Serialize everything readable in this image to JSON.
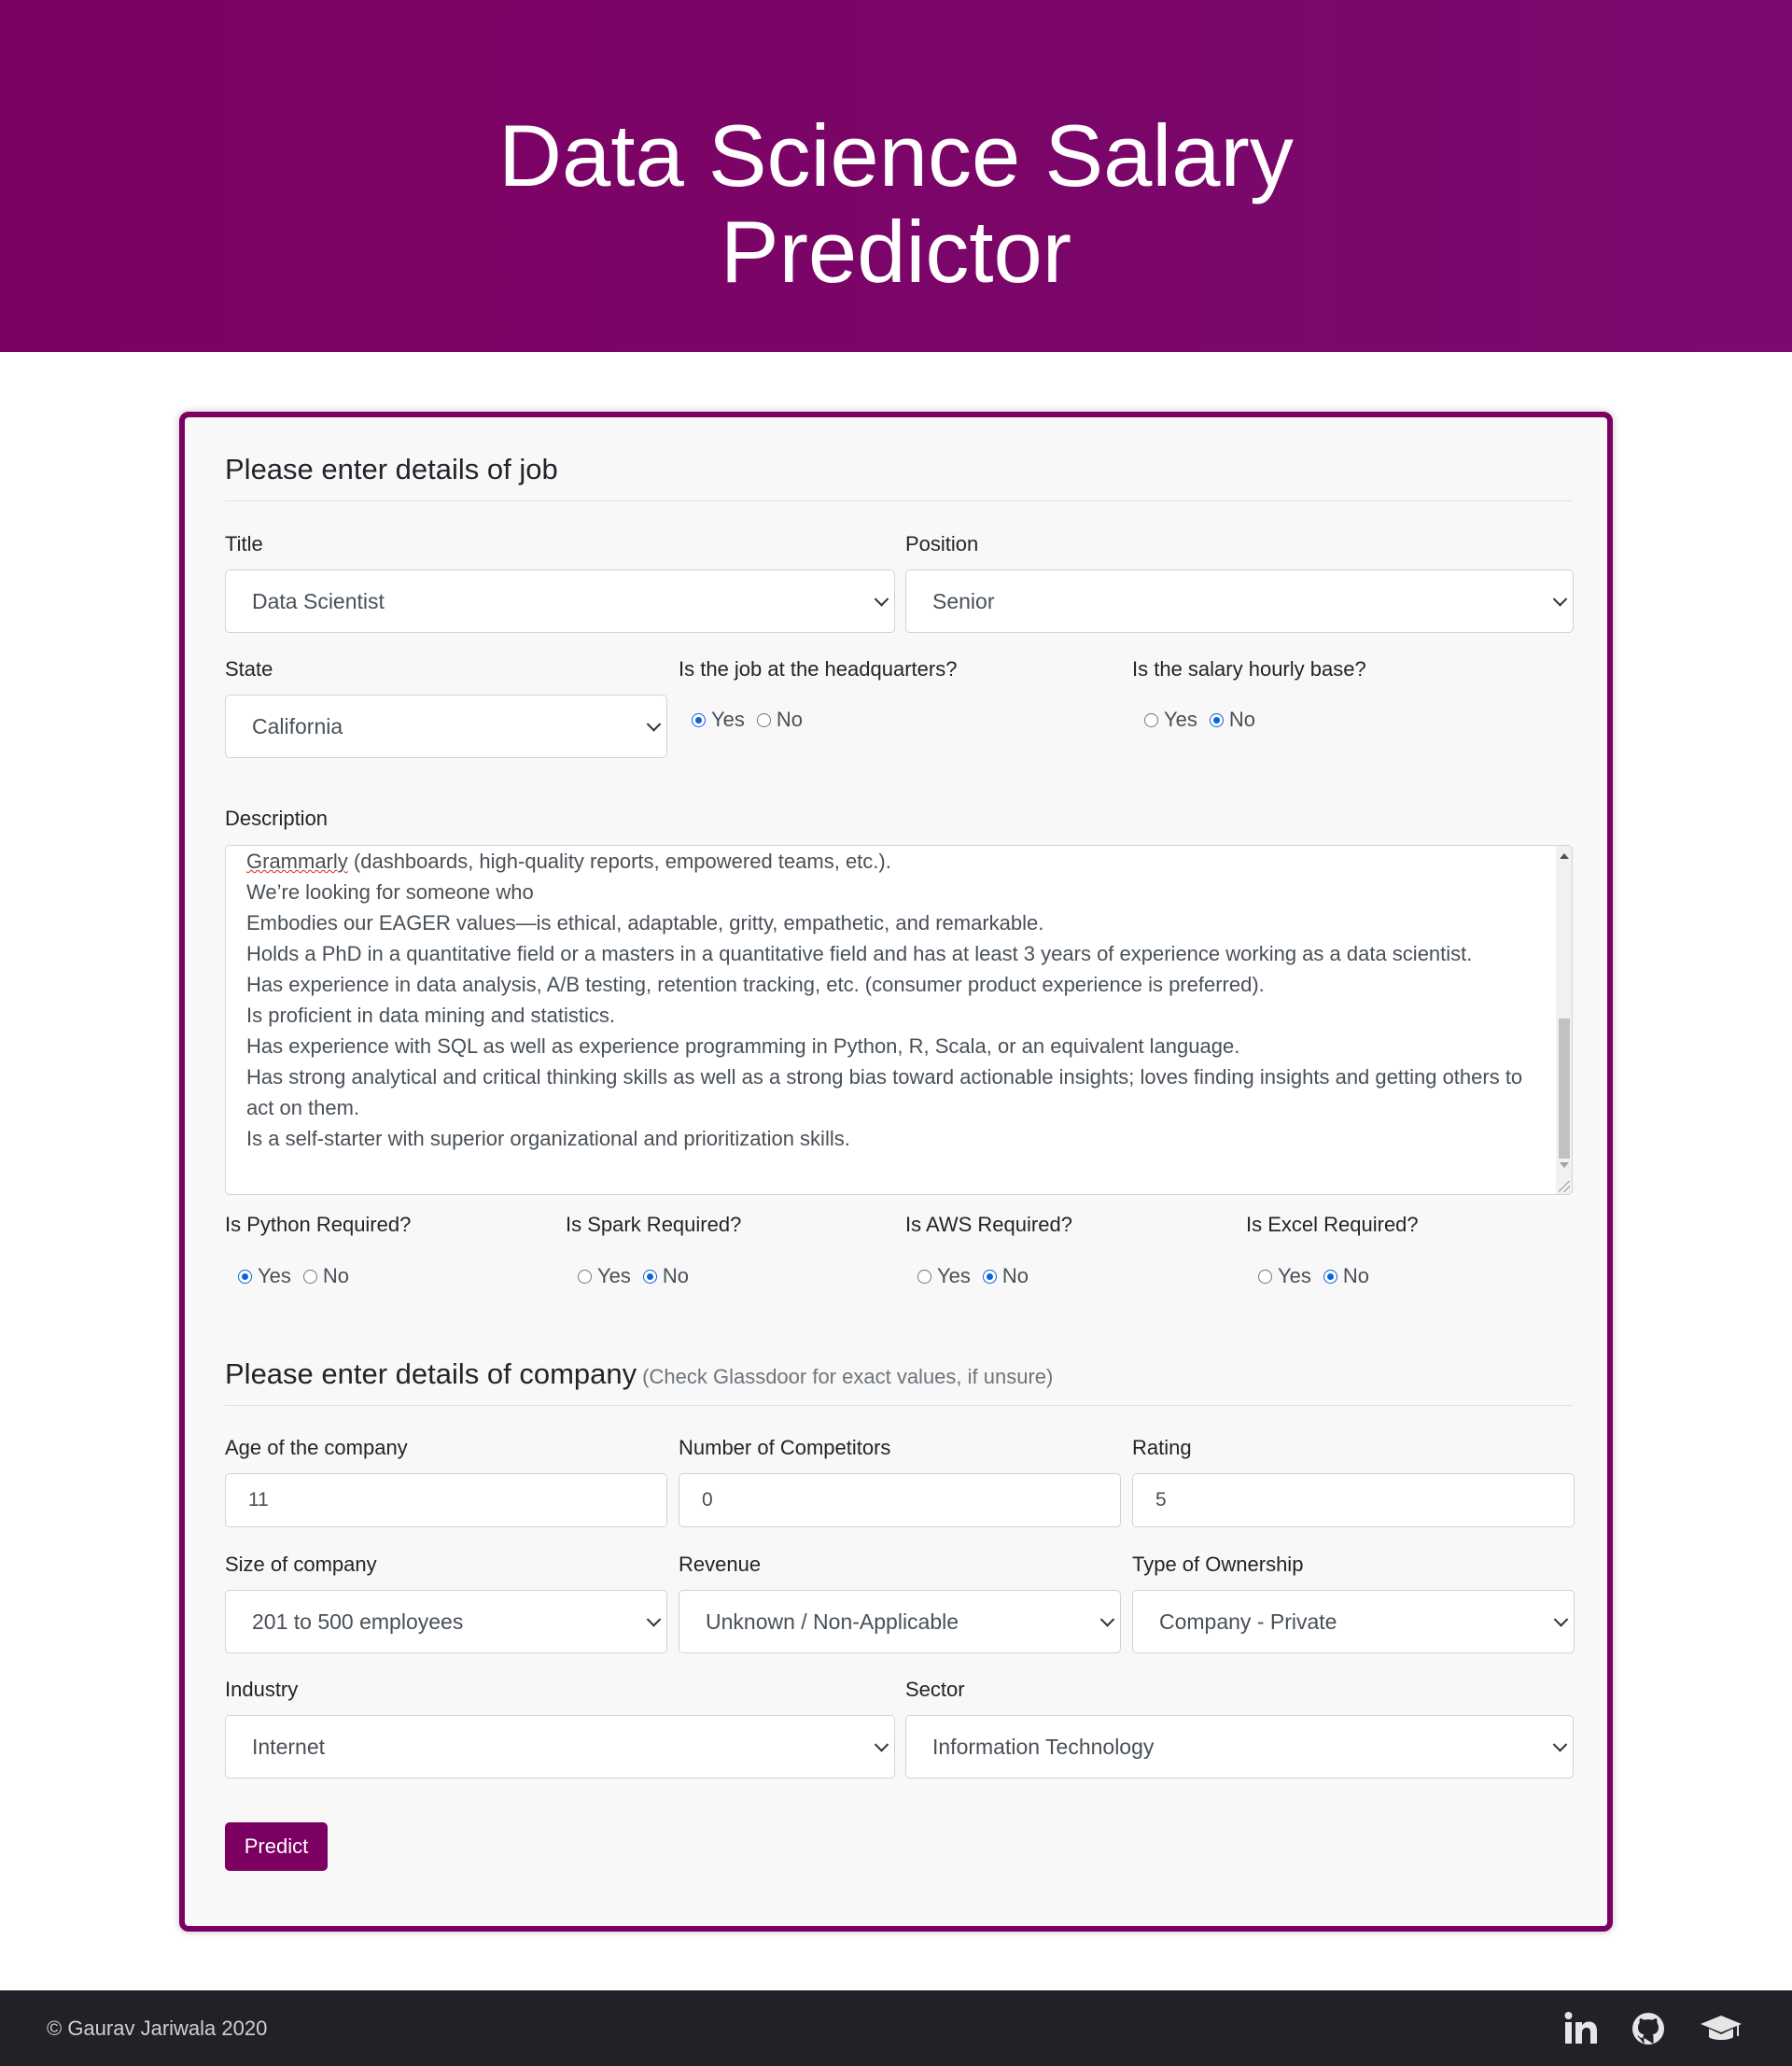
{
  "header": {
    "title": "Data Science Salary Predictor"
  },
  "job_section": {
    "legend": "Please enter details of job",
    "title": {
      "label": "Title",
      "value": "Data Scientist"
    },
    "position": {
      "label": "Position",
      "value": "Senior"
    },
    "state": {
      "label": "State",
      "value": "California"
    },
    "headquarters": {
      "label": "Is the job at the headquarters?",
      "yes": "Yes",
      "no": "No",
      "selected": "Yes"
    },
    "hourly": {
      "label": "Is the salary hourly base?",
      "yes": "Yes",
      "no": "No",
      "selected": "No"
    },
    "description": {
      "label": "Description",
      "misspelled_word": "Grammarly",
      "first_line_rest": " (dashboards, high-quality reports, empowered teams, etc.).",
      "lines": [
        "We’re looking for someone who",
        "Embodies our EAGER values—is ethical, adaptable, gritty, empathetic, and remarkable.",
        "Holds a PhD in a quantitative field or a masters in a quantitative field and has at least 3 years of experience working as a data scientist.",
        "Has experience in data analysis, A/B testing, retention tracking, etc. (consumer product experience is preferred).",
        "Is proficient in data mining and statistics.",
        "Has experience with SQL as well as experience programming in Python, R, Scala, or an equivalent language.",
        "Has strong analytical and critical thinking skills as well as a strong bias toward actionable insights; loves finding insights and getting others to act on them.",
        "Is a self-starter with superior organizational and prioritization skills."
      ]
    },
    "python": {
      "label": "Is Python Required?",
      "yes": "Yes",
      "no": "No",
      "selected": "Yes"
    },
    "spark": {
      "label": "Is Spark Required?",
      "yes": "Yes",
      "no": "No",
      "selected": "No"
    },
    "aws": {
      "label": "Is AWS Required?",
      "yes": "Yes",
      "no": "No",
      "selected": "No"
    },
    "excel": {
      "label": "Is Excel Required?",
      "yes": "Yes",
      "no": "No",
      "selected": "No"
    }
  },
  "company_section": {
    "legend": "Please enter details of company",
    "hint": "(Check Glassdoor for exact values, if unsure)",
    "age": {
      "label": "Age of the company",
      "value": "11"
    },
    "competitors": {
      "label": "Number of Competitors",
      "value": "0"
    },
    "rating": {
      "label": "Rating",
      "value": "5"
    },
    "size": {
      "label": "Size of company",
      "value": "201 to 500 employees"
    },
    "revenue": {
      "label": "Revenue",
      "value": "Unknown / Non-Applicable"
    },
    "ownership": {
      "label": "Type of Ownership",
      "value": "Company - Private"
    },
    "industry": {
      "label": "Industry",
      "value": "Internet"
    },
    "sector": {
      "label": "Sector",
      "value": "Information Technology"
    }
  },
  "predict_button": "Predict",
  "footer": {
    "copyright": "© Gaurav Jariwala 2020",
    "icons": [
      "linkedin-icon",
      "github-icon",
      "graduation-cap-icon"
    ]
  },
  "colors": {
    "brand": "#7c0061",
    "radio_selected": "#0b63d9",
    "footer_bg": "#202228"
  }
}
